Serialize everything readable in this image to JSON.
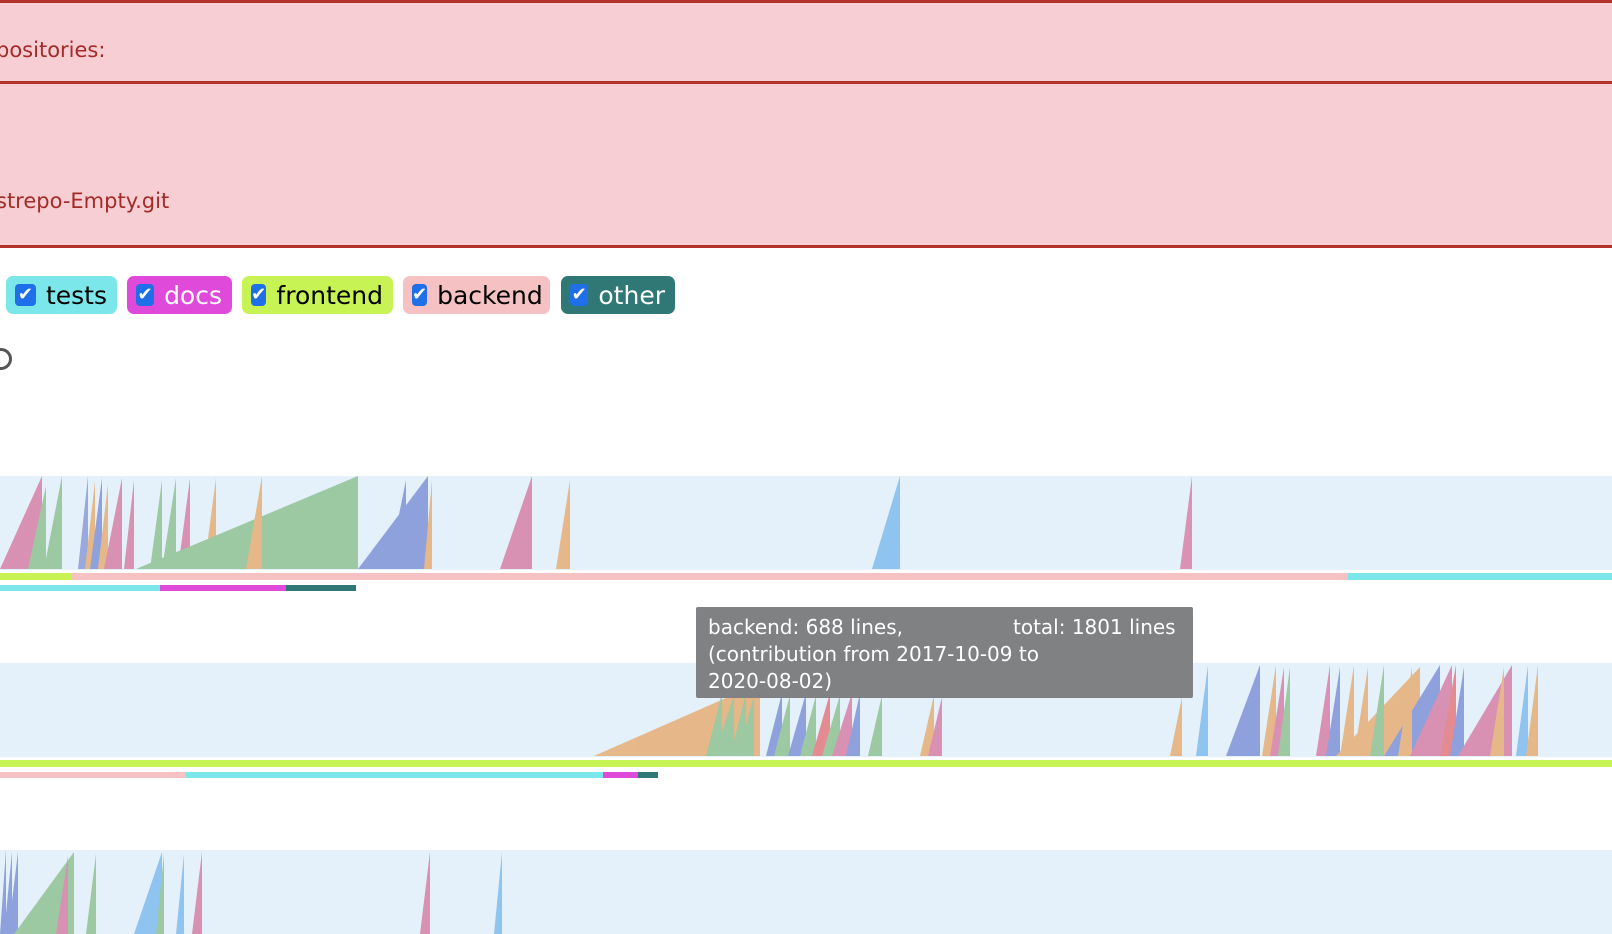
{
  "errors": [
    {
      "text": "positories:"
    },
    {
      "text": "strepo-Empty.git"
    }
  ],
  "filters": [
    {
      "label": "tests",
      "checked": true,
      "color": "#7ce7ea"
    },
    {
      "label": "docs",
      "checked": true,
      "color": "#e04adb"
    },
    {
      "label": "frontend",
      "checked": true,
      "color": "#c7f355"
    },
    {
      "label": "backend",
      "checked": true,
      "color": "#f5c1c2"
    },
    {
      "label": "other",
      "checked": true,
      "color": "#2f7876"
    }
  ],
  "checkmark": "✔",
  "tooltip": {
    "line1": "backend: 688 lines,",
    "total": "total: 1801 lines",
    "line2": "(contribution from 2017-10-09 to",
    "line3": "2020-08-02)"
  },
  "colors": {
    "ramp_background": "#e4f0fa",
    "tooltip_background": "#808182",
    "error_background": "#f7ced3",
    "error_border": "#b3322c"
  },
  "authors": [
    {
      "file_type_breakdown": [
        {
          "type": "frontend",
          "fraction": 0.045
        },
        {
          "type": "backend",
          "fraction": 0.815
        },
        {
          "type": "tests",
          "fraction": 0.14
        }
      ],
      "contribution_breakdown": [
        {
          "type": "tests",
          "share": 0.448
        },
        {
          "type": "docs",
          "share": 0.354
        },
        {
          "type": "other",
          "share": 0.198
        }
      ]
    },
    {
      "file_type_breakdown": [
        {
          "type": "frontend",
          "fraction": 1.0
        }
      ],
      "contribution_breakdown": [
        {
          "type": "backend",
          "share": 0.283
        },
        {
          "type": "tests",
          "share": 0.634
        },
        {
          "type": "docs",
          "share": 0.053
        },
        {
          "type": "other",
          "share": 0.03
        }
      ]
    },
    {
      "file_type_breakdown": [],
      "contribution_breakdown": []
    }
  ]
}
